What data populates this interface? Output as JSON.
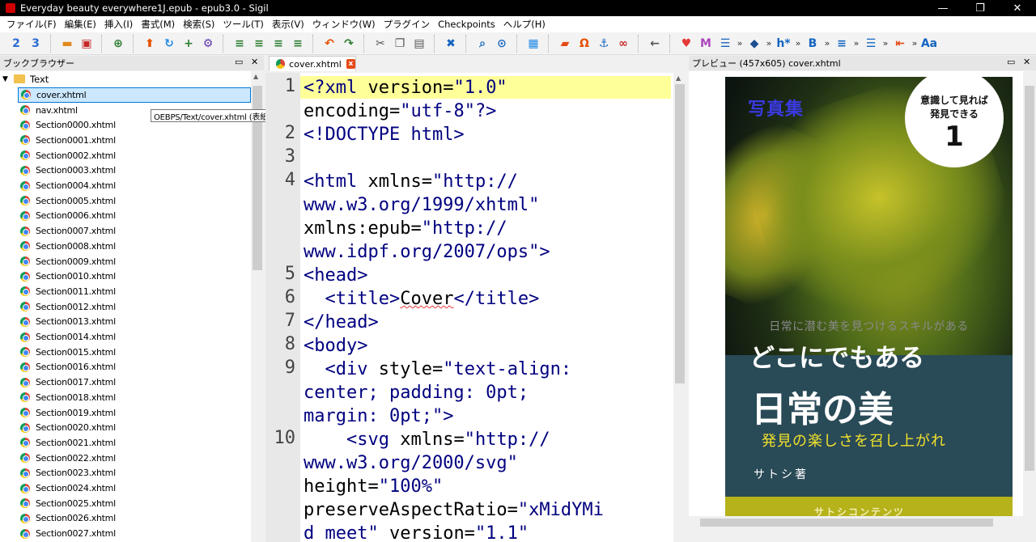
{
  "window": {
    "title": "Everyday beauty everywhere1J.epub - epub3.0 - Sigil",
    "minimize": "—",
    "restore": "❐",
    "close": "✕"
  },
  "menu": [
    "ファイル(F)",
    "編集(E)",
    "挿入(I)",
    "書式(M)",
    "検索(S)",
    "ツール(T)",
    "表示(V)",
    "ウィンドウ(W)",
    "プラグイン",
    "Checkpoints",
    "ヘルプ(H)"
  ],
  "toolbar": [
    {
      "name": "save-as-2-icon",
      "glyph": "2",
      "color": "#2b6cd4"
    },
    {
      "name": "save-as-3-icon",
      "glyph": "3",
      "color": "#2b6cd4"
    },
    {
      "sep": true
    },
    {
      "name": "open-folder-icon",
      "glyph": "▬",
      "color": "#e08a1e"
    },
    {
      "name": "save-icon",
      "glyph": "▣",
      "color": "#c62828"
    },
    {
      "sep": true
    },
    {
      "name": "add-file-icon",
      "glyph": "⊕",
      "color": "#2e7d32"
    },
    {
      "sep": true
    },
    {
      "name": "move-up-icon",
      "glyph": "⬆",
      "color": "#e65100"
    },
    {
      "name": "refresh-icon",
      "glyph": "↻",
      "color": "#1e88e5"
    },
    {
      "name": "add-existing-icon",
      "glyph": "+",
      "color": "#2e7d32"
    },
    {
      "name": "settings-icon",
      "glyph": "⚙",
      "color": "#5e35b1"
    },
    {
      "sep": true
    },
    {
      "name": "indent-left-icon",
      "glyph": "≡",
      "color": "#2e7d32"
    },
    {
      "name": "insert-icon",
      "glyph": "≡",
      "color": "#2e7d32"
    },
    {
      "name": "indent-right-icon",
      "glyph": "≡",
      "color": "#2e7d32"
    },
    {
      "name": "merge-icon",
      "glyph": "≡",
      "color": "#2e7d32"
    },
    {
      "sep": true
    },
    {
      "name": "undo-icon",
      "glyph": "↶",
      "color": "#e65100"
    },
    {
      "name": "redo-icon",
      "glyph": "↷",
      "color": "#2e7d32"
    },
    {
      "sep": true
    },
    {
      "name": "cut-icon",
      "glyph": "✂",
      "color": "#555555"
    },
    {
      "name": "copy-icon",
      "glyph": "❐",
      "color": "#555555"
    },
    {
      "name": "paste-icon",
      "glyph": "▤",
      "color": "#555555"
    },
    {
      "sep": true
    },
    {
      "name": "delete-icon",
      "glyph": "✖",
      "color": "#1565c0"
    },
    {
      "sep": true
    },
    {
      "name": "search-icon",
      "glyph": "⌕",
      "color": "#1565c0"
    },
    {
      "name": "zoom-icon",
      "glyph": "⊙",
      "color": "#1565c0"
    },
    {
      "sep": true
    },
    {
      "name": "split-icon",
      "glyph": "▦",
      "color": "#1e88e5"
    },
    {
      "sep": true
    },
    {
      "name": "insert-image-icon",
      "glyph": "▰",
      "color": "#e64a19"
    },
    {
      "name": "special-char-icon",
      "glyph": "Ω",
      "color": "#e65100"
    },
    {
      "name": "anchor-icon",
      "glyph": "⚓",
      "color": "#1565c0"
    },
    {
      "name": "link-icon",
      "glyph": "∞",
      "color": "#c62828"
    },
    {
      "sep": true
    },
    {
      "name": "back-icon",
      "glyph": "←",
      "color": "#555555"
    },
    {
      "sep": true
    },
    {
      "name": "heart-icon",
      "glyph": "♥",
      "color": "#e53935"
    },
    {
      "name": "metadata-icon",
      "glyph": "M",
      "color": "#ab47bc"
    },
    {
      "name": "toc-icon",
      "glyph": "☰",
      "color": "#1565c0"
    },
    {
      "more": true
    },
    {
      "name": "plugin-icon",
      "glyph": "◆",
      "color": "#1e4f91"
    },
    {
      "more": true
    },
    {
      "name": "heading-icon",
      "glyph": "h*",
      "color": "#1565c0"
    },
    {
      "more": true
    },
    {
      "name": "bold-icon",
      "glyph": "B",
      "color": "#1565c0"
    },
    {
      "more": true
    },
    {
      "name": "align-left-icon",
      "glyph": "≡",
      "color": "#1565c0"
    },
    {
      "more": true
    },
    {
      "name": "bullet-list-icon",
      "glyph": "☰",
      "color": "#1565c0"
    },
    {
      "more": true
    },
    {
      "name": "outdent-icon",
      "glyph": "⇤",
      "color": "#e64a19"
    },
    {
      "more": true
    },
    {
      "name": "case-icon",
      "glyph": "Aa",
      "color": "#1565c0"
    }
  ],
  "book_browser": {
    "title": "ブックブラウザー",
    "float": "▭",
    "close": "✕",
    "folder": "Text",
    "files": [
      "cover.xhtml",
      "nav.xhtml",
      "Section0000.xhtml",
      "Section0001.xhtml",
      "Section0002.xhtml",
      "Section0003.xhtml",
      "Section0004.xhtml",
      "Section0005.xhtml",
      "Section0006.xhtml",
      "Section0007.xhtml",
      "Section0008.xhtml",
      "Section0009.xhtml",
      "Section0010.xhtml",
      "Section0011.xhtml",
      "Section0012.xhtml",
      "Section0013.xhtml",
      "Section0014.xhtml",
      "Section0015.xhtml",
      "Section0016.xhtml",
      "Section0017.xhtml",
      "Section0018.xhtml",
      "Section0019.xhtml",
      "Section0020.xhtml",
      "Section0021.xhtml",
      "Section0022.xhtml",
      "Section0023.xhtml",
      "Section0024.xhtml",
      "Section0025.xhtml",
      "Section0026.xhtml",
      "Section0027.xhtml"
    ],
    "selected": 0,
    "tooltip": "OEBPS/Text/cover.xhtml (表紙) [svg]"
  },
  "editor": {
    "tab": "cover.xhtml",
    "tab_close": "x",
    "lines": [
      {
        "num": "1",
        "parts": [
          [
            "tag",
            "<?xml "
          ],
          [
            "attr",
            "version="
          ],
          [
            "val",
            "\"1.0\""
          ]
        ]
      },
      {
        "num": "",
        "parts": [
          [
            "attr",
            "encoding="
          ],
          [
            "val",
            "\"utf-8\""
          ],
          [
            "tag",
            "?>"
          ]
        ]
      },
      {
        "num": "2",
        "parts": [
          [
            "tag",
            "<!DOCTYPE html>"
          ]
        ]
      },
      {
        "num": "3",
        "parts": []
      },
      {
        "num": "4",
        "parts": [
          [
            "tag",
            "<html "
          ],
          [
            "attr",
            "xmlns="
          ],
          [
            "val",
            "\"http://"
          ]
        ]
      },
      {
        "num": "",
        "parts": [
          [
            "val",
            "www.w3.org/1999/xhtml\""
          ]
        ]
      },
      {
        "num": "",
        "parts": [
          [
            "attr",
            "xmlns:epub="
          ],
          [
            "val",
            "\"http://"
          ]
        ]
      },
      {
        "num": "",
        "parts": [
          [
            "val",
            "www.idpf.org/2007/ops\""
          ],
          [
            "tag",
            ">"
          ]
        ]
      },
      {
        "num": "5",
        "parts": [
          [
            "tag",
            "<head>"
          ]
        ]
      },
      {
        "num": "6",
        "parts": [
          [
            "txt",
            "  "
          ],
          [
            "tag",
            "<title>"
          ],
          [
            "squig",
            "Cover"
          ],
          [
            "tag",
            "</title>"
          ]
        ]
      },
      {
        "num": "7",
        "parts": [
          [
            "tag",
            "</head>"
          ]
        ]
      },
      {
        "num": "8",
        "parts": [
          [
            "tag",
            "<body>"
          ]
        ]
      },
      {
        "num": "9",
        "parts": [
          [
            "txt",
            "  "
          ],
          [
            "tag",
            "<div "
          ],
          [
            "attr",
            "style="
          ],
          [
            "val",
            "\"text-align:"
          ]
        ]
      },
      {
        "num": "",
        "parts": [
          [
            "val",
            "center; padding: 0pt;"
          ]
        ]
      },
      {
        "num": "",
        "parts": [
          [
            "val",
            "margin: 0pt;\""
          ],
          [
            "tag",
            ">"
          ]
        ]
      },
      {
        "num": "10",
        "parts": [
          [
            "txt",
            "    "
          ],
          [
            "tag",
            "<svg "
          ],
          [
            "attr",
            "xmlns="
          ],
          [
            "val",
            "\"http://"
          ]
        ]
      },
      {
        "num": "",
        "parts": [
          [
            "val",
            "www.w3.org/2000/svg\""
          ]
        ]
      },
      {
        "num": "",
        "parts": [
          [
            "attr",
            "height="
          ],
          [
            "val",
            "\"100%\""
          ]
        ]
      },
      {
        "num": "",
        "parts": [
          [
            "attr",
            "preserveAspectRatio="
          ],
          [
            "val",
            "\"xMidYMi"
          ]
        ]
      },
      {
        "num": "",
        "parts": [
          [
            "val",
            "d meet\" "
          ],
          [
            "attr",
            "version="
          ],
          [
            "val",
            "\"1.1\""
          ]
        ]
      }
    ]
  },
  "preview": {
    "title": "プレビュー (457x605) cover.xhtml",
    "float": "▭",
    "close": "✕",
    "cover": {
      "badge_text": "意識して見れば発見できる",
      "badge_number": "1",
      "photo_label": "写真集",
      "subtitle": "日常に潜む美を見つけるスキルがある",
      "title_line1": "どこにでもある",
      "title_line2": "日常の美",
      "catchphrase": "発見の楽しさを召し上がれ",
      "author": "サトシ著",
      "publisher": "サトシコンテンツ"
    }
  }
}
